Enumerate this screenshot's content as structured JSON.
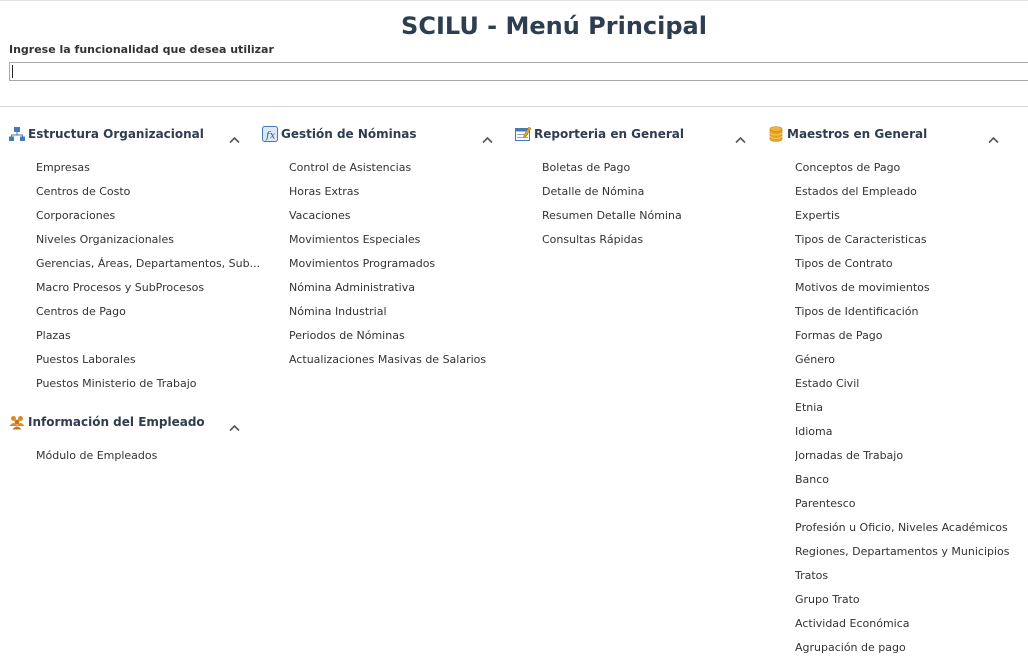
{
  "header": {
    "title": "SCILU - Menú Principal",
    "search_label": "Ingrese la funcionalidad que desea utilizar",
    "search_value": ""
  },
  "groups": [
    {
      "title": "Estructura Organizacional",
      "icon": "org-chart-icon",
      "items": [
        "Empresas",
        "Centros de Costo",
        "Corporaciones",
        "Niveles Organizacionales",
        "Gerencias, Áreas, Departamentos, Sub...",
        "Macro Procesos y SubProcesos",
        "Centros de Pago",
        "Plazas",
        "Puestos Laborales",
        "Puestos Ministerio de Trabajo"
      ]
    },
    {
      "title": "Información del Empleado",
      "icon": "people-icon",
      "items": [
        "Módulo de Empleados"
      ]
    },
    {
      "title": "Gestión de Nóminas",
      "icon": "function-icon",
      "items": [
        "Control de Asistencias",
        "Horas Extras",
        "Vacaciones",
        "Movimientos Especiales",
        "Movimientos Programados",
        "Nómina Administrativa",
        "Nómina Industrial",
        "Periodos de Nóminas",
        "Actualizaciones Masivas de Salarios"
      ]
    },
    {
      "title": "Reporteria en General",
      "icon": "report-icon",
      "items": [
        "Boletas de Pago",
        "Detalle de Nómina",
        "Resumen Detalle Nómina",
        "Consultas Rápidas"
      ]
    },
    {
      "title": "Maestros en General",
      "icon": "database-icon",
      "items": [
        "Conceptos de Pago",
        "Estados del Empleado",
        "Expertis",
        "Tipos de Caracteristicas",
        "Tipos de Contrato",
        "Motivos de movimientos",
        "Tipos de Identificación",
        "Formas de Pago",
        "Género",
        "Estado Civil",
        "Etnia",
        "Idioma",
        "Jornadas de Trabajo",
        "Banco",
        "Parentesco",
        "Profesión u Oficio, Niveles Académicos",
        "Regiones, Departamentos y Municipios",
        "Tratos",
        "Grupo Trato",
        "Actividad Económica",
        "Agrupación de pago"
      ]
    }
  ]
}
